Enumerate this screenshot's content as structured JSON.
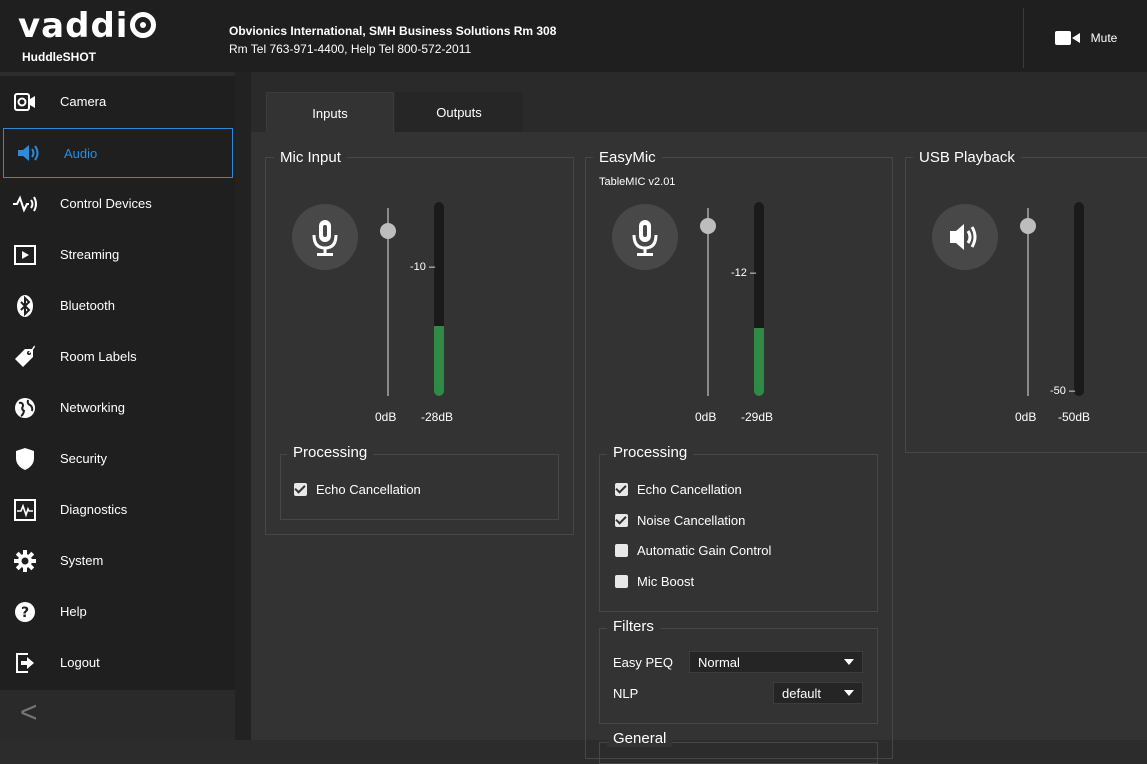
{
  "header": {
    "logo_text": "vaddi",
    "product_name": "HuddleSHOT",
    "org_line1": "Obvionics International, SMH Business Solutions Rm 308",
    "org_line2": "Rm Tel 763-971-4400, Help Tel 800-572-2011",
    "mute_label": "Mute"
  },
  "sidebar": {
    "items": [
      {
        "label": "Camera",
        "icon": "camera-icon"
      },
      {
        "label": "Audio",
        "icon": "speaker-icon",
        "active": true
      },
      {
        "label": "Control Devices",
        "icon": "control-devices-icon"
      },
      {
        "label": "Streaming",
        "icon": "play-icon"
      },
      {
        "label": "Bluetooth",
        "icon": "bluetooth-icon"
      },
      {
        "label": "Room Labels",
        "icon": "tag-icon"
      },
      {
        "label": "Networking",
        "icon": "globe-icon"
      },
      {
        "label": "Security",
        "icon": "shield-icon"
      },
      {
        "label": "Diagnostics",
        "icon": "pulse-icon"
      },
      {
        "label": "System",
        "icon": "gear-icon"
      },
      {
        "label": "Help",
        "icon": "help-icon"
      },
      {
        "label": "Logout",
        "icon": "logout-icon"
      }
    ],
    "collapse_glyph": "<"
  },
  "tabs": {
    "inputs": "Inputs",
    "outputs": "Outputs",
    "active": "Inputs"
  },
  "mic_input": {
    "title": "Mic Input",
    "meter_mark": "-10",
    "gain_label": "0dB",
    "level_label": "-28dB",
    "meter_level": 0.36,
    "processing": {
      "title": "Processing",
      "options": [
        {
          "label": "Echo Cancellation",
          "checked": true
        }
      ]
    }
  },
  "easymic": {
    "title": "EasyMic",
    "subtitle": "TableMIC v2.01",
    "meter_mark": "-12",
    "gain_label": "0dB",
    "level_label": "-29dB",
    "meter_level": 0.35,
    "processing": {
      "title": "Processing",
      "options": [
        {
          "label": "Echo Cancellation",
          "checked": true
        },
        {
          "label": "Noise Cancellation",
          "checked": true
        },
        {
          "label": "Automatic Gain Control",
          "checked": false
        },
        {
          "label": "Mic Boost",
          "checked": false
        }
      ]
    },
    "filters": {
      "title": "Filters",
      "easy_peq_label": "Easy PEQ",
      "easy_peq_value": "Normal",
      "nlp_label": "NLP",
      "nlp_value": "default"
    },
    "general_title": "General"
  },
  "usb_playback": {
    "title": "USB Playback",
    "meter_mark": "-50",
    "gain_label": "0dB",
    "level_label": "-50dB",
    "meter_level": 0.0
  },
  "colors": {
    "accent": "#2e8bdc",
    "meter_green": "#2f8a45",
    "background": "#333333"
  }
}
